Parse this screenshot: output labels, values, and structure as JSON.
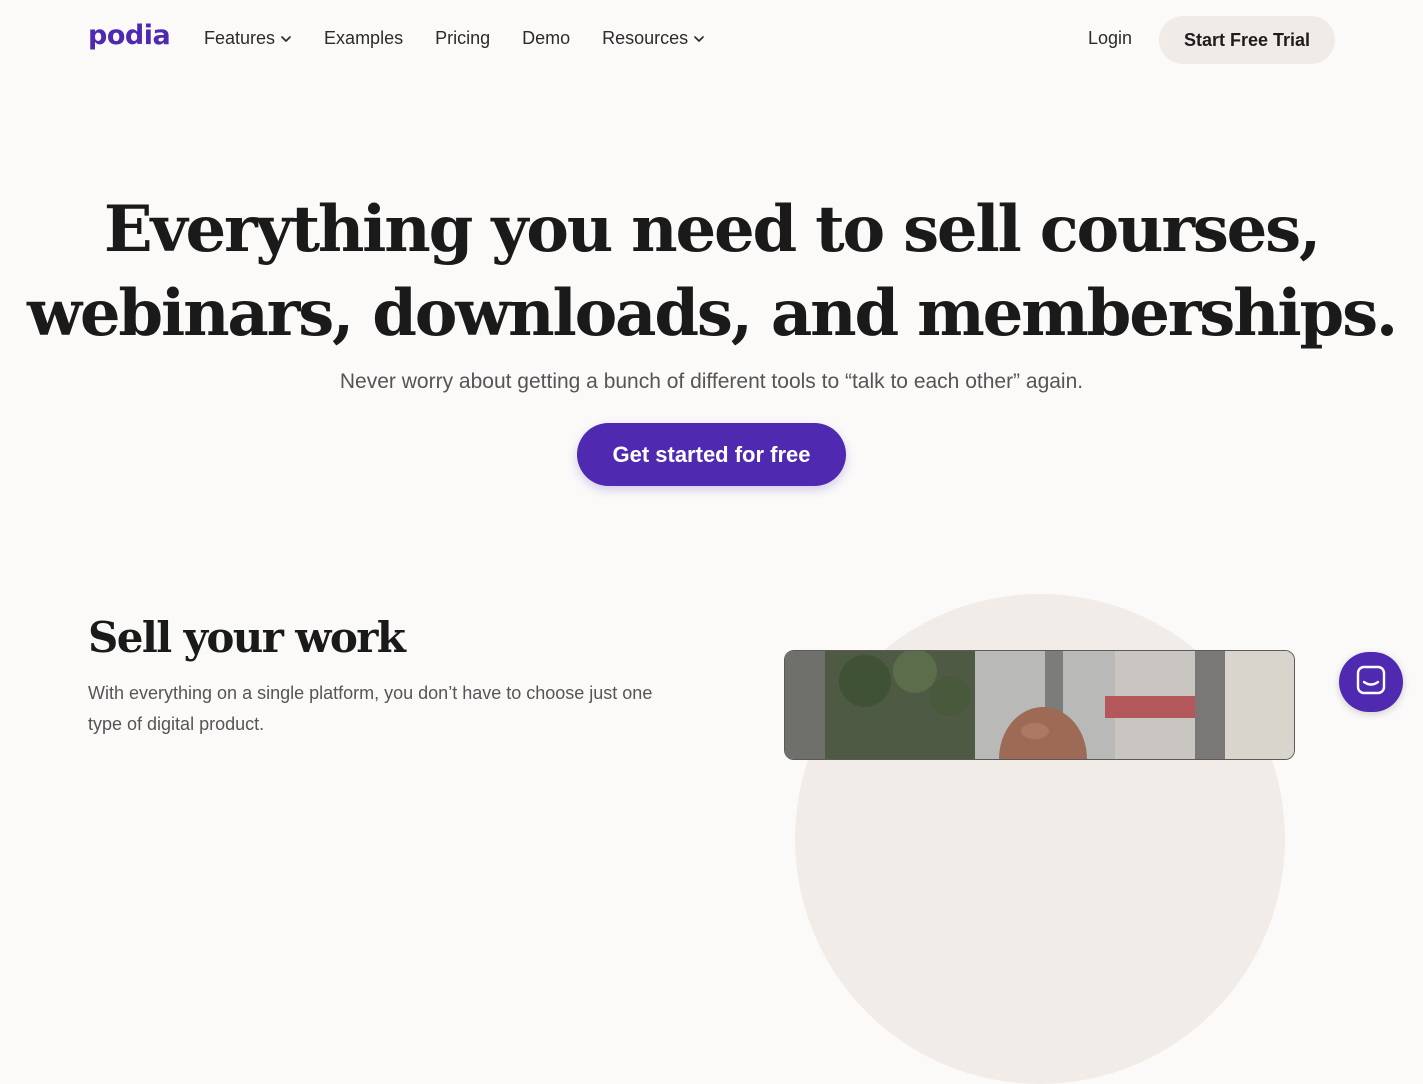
{
  "brand": {
    "logo_text": "podia",
    "accent_color": "#4f2ab0"
  },
  "nav": {
    "items": [
      {
        "label": "Features",
        "has_dropdown": true
      },
      {
        "label": "Examples",
        "has_dropdown": false
      },
      {
        "label": "Pricing",
        "has_dropdown": false
      },
      {
        "label": "Demo",
        "has_dropdown": false
      },
      {
        "label": "Resources",
        "has_dropdown": true
      }
    ],
    "login_label": "Login",
    "trial_label": "Start Free Trial"
  },
  "hero": {
    "title_line1": "Everything you need to sell courses,",
    "title_line2": "webinars, downloads, and memberships.",
    "subtitle": "Never worry about getting a bunch of different tools to “talk to each other” again.",
    "cta_label": "Get started for free"
  },
  "sell": {
    "title": "Sell your work",
    "text": "With everything on a single platform, you don’t have to choose just one type of digital product."
  },
  "icons": {
    "dropdown": "chevron-down-icon",
    "chat": "chat-icon"
  }
}
